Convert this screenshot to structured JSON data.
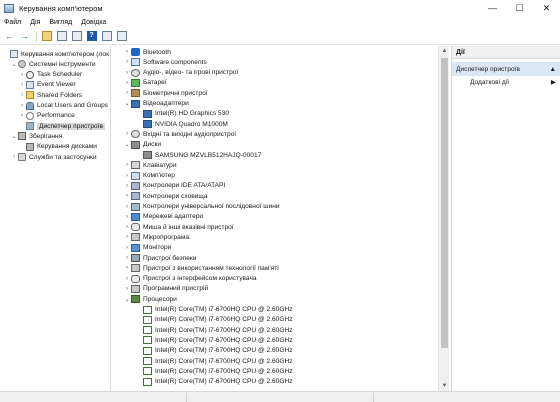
{
  "window": {
    "title": "Керування комп'ютером",
    "controls": {
      "minimize": "—",
      "maximize": "☐",
      "close": "✕"
    }
  },
  "menu": [
    {
      "label": "Файл"
    },
    {
      "label": "Дія"
    },
    {
      "label": "Вигляд"
    },
    {
      "label": "Довідка"
    }
  ],
  "toolbar": {
    "back": "←",
    "forward": "→",
    "help": "?"
  },
  "left_tree": [
    {
      "label": "Керування комп'ютером (лок",
      "icon": "computer-management-icon",
      "exp": "",
      "indent": 0
    },
    {
      "label": "Системні інструменти",
      "icon": "tools-icon",
      "exp": "⌄",
      "indent": 1
    },
    {
      "label": "Task Scheduler",
      "icon": "clock-icon",
      "exp": "›",
      "indent": 2
    },
    {
      "label": "Event Viewer",
      "icon": "event-viewer-icon",
      "exp": "›",
      "indent": 2
    },
    {
      "label": "Shared Folders",
      "icon": "folder-icon",
      "exp": "›",
      "indent": 2
    },
    {
      "label": "Local Users and Groups",
      "icon": "users-icon",
      "exp": "›",
      "indent": 2
    },
    {
      "label": "Performance",
      "icon": "performance-icon",
      "exp": "›",
      "indent": 2
    },
    {
      "label": "Диспетчер пристроїв",
      "icon": "device-manager-icon",
      "exp": "",
      "indent": 2,
      "selected": true
    },
    {
      "label": "Зберігання",
      "icon": "storage-icon",
      "exp": "⌄",
      "indent": 1
    },
    {
      "label": "Керування дисками",
      "icon": "disk-icon",
      "exp": "",
      "indent": 2
    },
    {
      "label": "Служби та застосунки",
      "icon": "services-icon",
      "exp": "›",
      "indent": 1
    }
  ],
  "device_tree": [
    {
      "label": "Bluetooth",
      "icon": "bluetooth-icon",
      "exp": "›",
      "indent": 0
    },
    {
      "label": "Software components",
      "icon": "software-components-icon",
      "exp": "›",
      "indent": 0
    },
    {
      "label": "Аудіо-, відео- та ігрові пристрої",
      "icon": "audio-icon",
      "exp": "›",
      "indent": 0
    },
    {
      "label": "Батареї",
      "icon": "battery-icon",
      "exp": "›",
      "indent": 0
    },
    {
      "label": "Біометричні пристрої",
      "icon": "biometric-icon",
      "exp": "›",
      "indent": 0
    },
    {
      "label": "Відеоадаптери",
      "icon": "video-adapter-icon",
      "exp": "⌄",
      "indent": 0
    },
    {
      "label": "Intel(R) HD Graphics 530",
      "icon": "video-adapter-icon",
      "exp": "",
      "indent": 1
    },
    {
      "label": "NVIDIA Quadro M1000M",
      "icon": "video-adapter-icon",
      "exp": "",
      "indent": 1
    },
    {
      "label": "Вхідні та вихідні аудіопристрої",
      "icon": "audio-io-icon",
      "exp": "›",
      "indent": 0
    },
    {
      "label": "Диски",
      "icon": "disk-drive-icon",
      "exp": "⌄",
      "indent": 0
    },
    {
      "label": "SAMSUNG MZVLB512HAJQ-00017",
      "icon": "disk-drive-icon",
      "exp": "",
      "indent": 1
    },
    {
      "label": "Клавіатури",
      "icon": "keyboard-icon",
      "exp": "›",
      "indent": 0
    },
    {
      "label": "Комп'ютер",
      "icon": "computer-icon",
      "exp": "›",
      "indent": 0
    },
    {
      "label": "Контролери IDE ATA/ATAPI",
      "icon": "ide-controller-icon",
      "exp": "›",
      "indent": 0
    },
    {
      "label": "Контролери сховища",
      "icon": "storage-controller-icon",
      "exp": "›",
      "indent": 0
    },
    {
      "label": "Контролери універсальної послідовної шини",
      "icon": "usb-controller-icon",
      "exp": "›",
      "indent": 0
    },
    {
      "label": "Мережеві адаптери",
      "icon": "network-adapter-icon",
      "exp": "›",
      "indent": 0
    },
    {
      "label": "Миша й інші вказівні пристрої",
      "icon": "mouse-icon",
      "exp": "›",
      "indent": 0
    },
    {
      "label": "Мікропрограма:",
      "icon": "firmware-icon",
      "exp": "›",
      "indent": 0
    },
    {
      "label": "Монітори",
      "icon": "monitor-icon",
      "exp": "›",
      "indent": 0
    },
    {
      "label": "Пристрої безпеки",
      "icon": "security-device-icon",
      "exp": "›",
      "indent": 0
    },
    {
      "label": "Пристрої з використанням технології пам'яті",
      "icon": "memory-device-icon",
      "exp": "›",
      "indent": 0
    },
    {
      "label": "Пристрої з інтерфейсом користувача",
      "icon": "hid-icon",
      "exp": "›",
      "indent": 0
    },
    {
      "label": "Програмний пристрій",
      "icon": "software-device-icon",
      "exp": "›",
      "indent": 0
    },
    {
      "label": "Процесори",
      "icon": "processor-icon",
      "exp": "⌄",
      "indent": 0
    },
    {
      "label": "Intel(R) Core(TM) i7-6700HQ CPU @ 2.60GHz",
      "icon": "processor-icon",
      "exp": "",
      "indent": 1
    },
    {
      "label": "Intel(R) Core(TM) i7-6700HQ CPU @ 2.60GHz",
      "icon": "processor-icon",
      "exp": "",
      "indent": 1
    },
    {
      "label": "Intel(R) Core(TM) i7-6700HQ CPU @ 2.60GHz",
      "icon": "processor-icon",
      "exp": "",
      "indent": 1
    },
    {
      "label": "Intel(R) Core(TM) i7-6700HQ CPU @ 2.60GHz",
      "icon": "processor-icon",
      "exp": "",
      "indent": 1
    },
    {
      "label": "Intel(R) Core(TM) i7-6700HQ CPU @ 2.60GHz",
      "icon": "processor-icon",
      "exp": "",
      "indent": 1
    },
    {
      "label": "Intel(R) Core(TM) i7-6700HQ CPU @ 2.60GHz",
      "icon": "processor-icon",
      "exp": "",
      "indent": 1
    },
    {
      "label": "Intel(R) Core(TM) i7-6700HQ CPU @ 2.60GHz",
      "icon": "processor-icon",
      "exp": "",
      "indent": 1
    },
    {
      "label": "Intel(R) Core(TM) i7-6700HQ CPU @ 2.60GHz",
      "icon": "processor-icon",
      "exp": "",
      "indent": 1
    }
  ],
  "actions": {
    "header": "Дії",
    "section": "Диспетчер пристроїв",
    "section_arrow": "▲",
    "item": "Додаткові дії",
    "item_arrow": "▶"
  },
  "colors": {
    "selection": "#d9d9d9",
    "actions_section_bg": "#dbe7f4",
    "accent": "#1f5fa8"
  }
}
